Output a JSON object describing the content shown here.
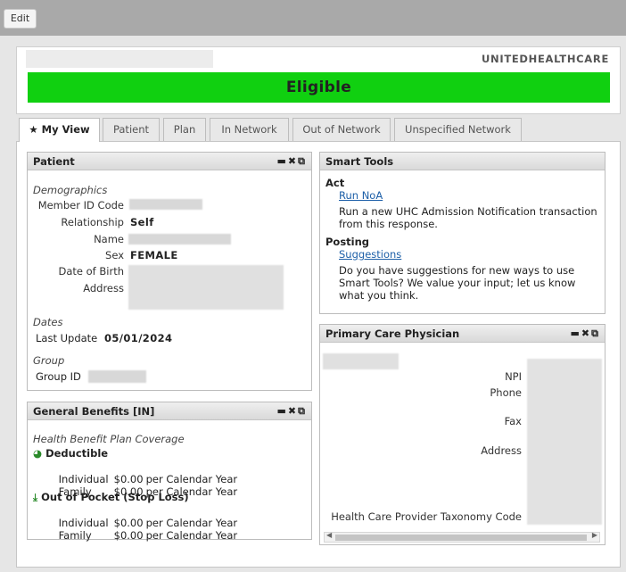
{
  "toolbar": {
    "edit_label": "Edit"
  },
  "header": {
    "payer": "UNITEDHEALTHCARE",
    "status": "Eligible",
    "status_color": "#10d010"
  },
  "tabs": [
    {
      "label": "My View",
      "icon": "star-icon",
      "active": true
    },
    {
      "label": "Patient"
    },
    {
      "label": "Plan"
    },
    {
      "label": "In Network"
    },
    {
      "label": "Out of Network"
    },
    {
      "label": "Unspecified Network"
    }
  ],
  "patient_panel": {
    "title": "Patient",
    "demographics_label": "Demographics",
    "member_id_label": "Member ID Code",
    "relationship_label": "Relationship",
    "relationship_value": "Self",
    "name_label": "Name",
    "sex_label": "Sex",
    "sex_value": "FEMALE",
    "dob_label": "Date of Birth",
    "address_label": "Address",
    "dates_label": "Dates",
    "last_update_label": "Last Update",
    "last_update_value": "05/01/2024",
    "group_label": "Group",
    "group_id_label": "Group ID"
  },
  "smart_tools": {
    "title": "Smart Tools",
    "act_label": "Act",
    "run_noa_link": "Run NoA",
    "run_noa_desc_1": "Run a new UHC Admission Notification transaction",
    "run_noa_desc_2": "from this response.",
    "posting_label": "Posting",
    "suggestions_link": "Suggestions",
    "suggestions_desc_1": "Do you have suggestions for new ways to use",
    "suggestions_desc_2": "Smart Tools? We value your input; let us know",
    "suggestions_desc_3": "what you think."
  },
  "general_benefits": {
    "title": "General Benefits [IN]",
    "coverage_label": "Health Benefit Plan Coverage",
    "deductible_label": "Deductible",
    "deductible_rows": [
      {
        "who": "Individual",
        "amount": "$0.00",
        "period": "per Calendar Year"
      },
      {
        "who": "Family",
        "amount": "$0.00",
        "period": "per Calendar Year"
      }
    ],
    "oop_label": "Out of Pocket (Stop Loss)",
    "oop_rows": [
      {
        "who": "Individual",
        "amount": "$0.00",
        "period": "per Calendar Year"
      },
      {
        "who": "Family",
        "amount": "$0.00",
        "period": "per Calendar Year"
      }
    ]
  },
  "pcp": {
    "title": "Primary Care Physician",
    "npi_label": "NPI",
    "phone_label": "Phone",
    "fax_label": "Fax",
    "address_label": "Address",
    "taxonomy_label": "Health Care Provider Taxonomy Code"
  },
  "icons": [
    "minimize-icon",
    "close-icon",
    "popout-icon",
    "deductible-pie-icon",
    "download-arrow-icon"
  ]
}
